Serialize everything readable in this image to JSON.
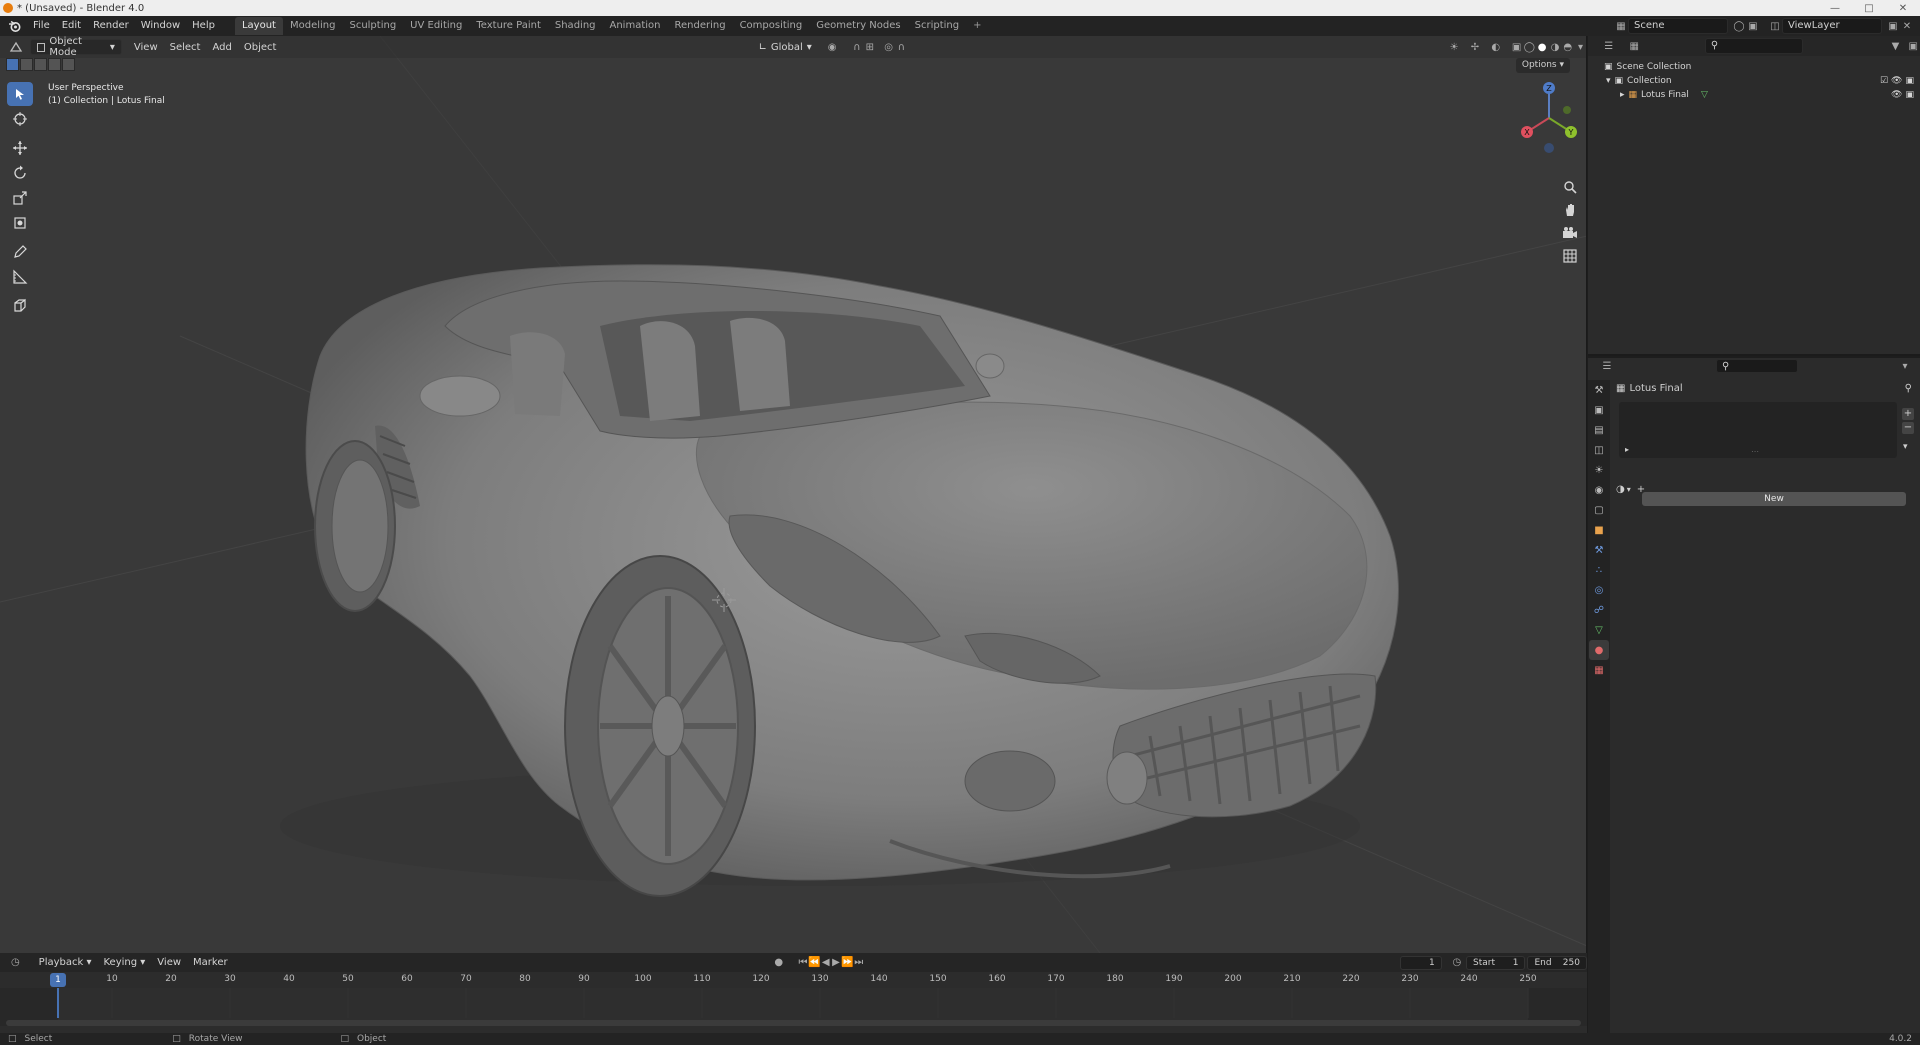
{
  "window": {
    "title": "* (Unsaved) - Blender 4.0"
  },
  "menubar": {
    "menus": [
      "File",
      "Edit",
      "Render",
      "Window",
      "Help"
    ],
    "workspaces": [
      "Layout",
      "Modeling",
      "Sculpting",
      "UV Editing",
      "Texture Paint",
      "Shading",
      "Animation",
      "Rendering",
      "Compositing",
      "Geometry Nodes",
      "Scripting"
    ],
    "add_tab": "+",
    "scene": "Scene",
    "view_layer": "ViewLayer"
  },
  "viewport": {
    "mode": "Object Mode",
    "menus": [
      "View",
      "Select",
      "Add",
      "Object"
    ],
    "orientation": "Global",
    "options": "Options",
    "overlay_line1": "User Perspective",
    "overlay_line2": "(1) Collection | Lotus Final",
    "gizmo": {
      "x": "X",
      "y": "Y",
      "z": "Z"
    }
  },
  "outliner": {
    "scene_collection": "Scene Collection",
    "collection": "Collection",
    "object": "Lotus Final"
  },
  "properties": {
    "object_name": "Lotus Final",
    "new_button": "New"
  },
  "timeline": {
    "menus": [
      "Playback",
      "Keying",
      "View",
      "Marker"
    ],
    "current_frame": "1",
    "start_label": "Start",
    "start": "1",
    "end_label": "End",
    "end": "250",
    "ticks": [
      "10",
      "20",
      "30",
      "40",
      "50",
      "60",
      "70",
      "80",
      "90",
      "100",
      "110",
      "120",
      "130",
      "140",
      "150",
      "160",
      "170",
      "180",
      "190",
      "200",
      "210",
      "220",
      "230",
      "240",
      "250"
    ]
  },
  "statusbar": {
    "select": "Select",
    "rotate_view": "Rotate View",
    "object": "Object",
    "version": "4.0.2"
  }
}
